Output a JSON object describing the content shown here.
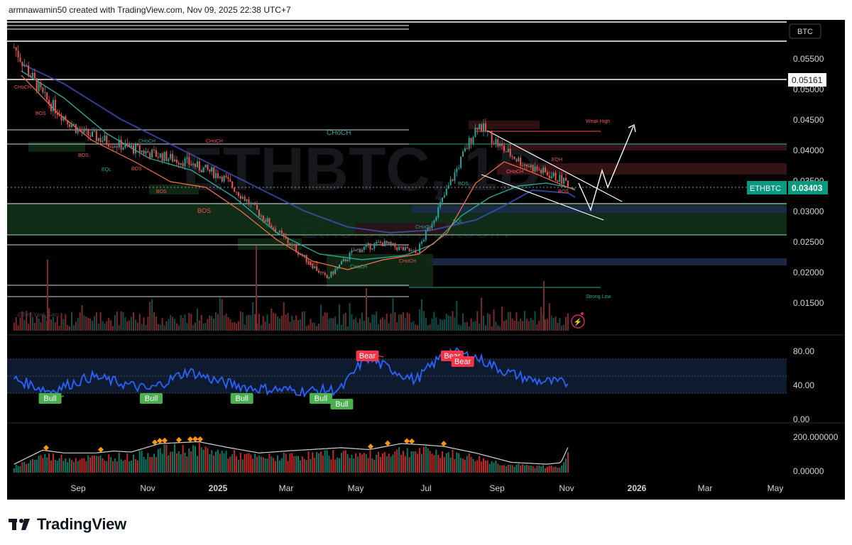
{
  "header": {
    "credit": "armnawamin50 created with TradingView.com, Nov 09, 2025 22:38 UTC+7"
  },
  "footer": {
    "brand": "TradingView"
  },
  "watermark": {
    "symbol": "ETHBTC, 1D",
    "name": "Ethereum / Bitcoin"
  },
  "author_tag": "@NeoYael_Sam",
  "price_axis": {
    "currency_badge": "BTC",
    "ticks": [
      "0.05500",
      "0.05000",
      "0.04500",
      "0.04000",
      "0.03500",
      "0.03000",
      "0.02500",
      "0.02000",
      "0.01500"
    ],
    "level_label": "0.05161",
    "symbol_tag": "ETHBTC",
    "last_price": "0.03403"
  },
  "rsi_axis": {
    "ticks": [
      "80.00",
      "40.00",
      "0.00"
    ]
  },
  "osc_axis": {
    "ticks": [
      "200.000000",
      "0.00000"
    ]
  },
  "time_axis": {
    "labels": [
      "Sep",
      "Nov",
      "2025",
      "Mar",
      "May",
      "Jul",
      "Sep",
      "Nov",
      "2026",
      "Mar",
      "May"
    ]
  },
  "annotations": {
    "choch_big": "CHoCH",
    "bos_big": "BOS",
    "weak_high": "Weak High",
    "strong_low": "Strong Low",
    "eqh": "EQH",
    "eql": "EQL",
    "small_bos": "BOS",
    "small_choch": "CHoCH",
    "bull": "Bull",
    "bear": "Bear"
  },
  "colors": {
    "background": "#000000",
    "up": "#26a69a",
    "down": "#ef5350",
    "rsi_line": "#2962ff",
    "badge_teal": "#089981",
    "bull_badge": "#4caf50",
    "bear_badge": "#f23645",
    "diamond": "#ff9800"
  },
  "chart_data": [
    {
      "type": "line",
      "title": "ETHBTC, 1D",
      "subtitle": "Ethereum / Bitcoin",
      "x": [
        "2024-07-20",
        "2024-08-15",
        "2024-09-15",
        "2024-10-15",
        "2024-11-15",
        "2024-12-15",
        "2025-01-15",
        "2025-02-15",
        "2025-03-15",
        "2025-04-15",
        "2025-05-08",
        "2025-06-01",
        "2025-07-01",
        "2025-07-20",
        "2025-08-23",
        "2025-09-15",
        "2025-10-01",
        "2025-10-20",
        "2025-11-09"
      ],
      "series": [
        {
          "values": [
            0.0548,
            0.047,
            0.0418,
            0.04,
            0.0385,
            0.0372,
            0.035,
            0.0295,
            0.0245,
            0.0193,
            0.0235,
            0.0248,
            0.0232,
            0.03,
            0.0431,
            0.039,
            0.037,
            0.0355,
            0.034
          ]
        }
      ],
      "ylim": [
        0.011,
        0.059
      ],
      "last_price": 0.03403,
      "horizontal_levels": [
        0.05161,
        0.0431,
        0.0409,
        0.0314,
        0.0246,
        0.018,
        0.0162
      ]
    },
    {
      "type": "line",
      "ylim": [
        0,
        100
      ],
      "signals": [
        {
          "label": "Bull",
          "x": "2024-08-20"
        },
        {
          "label": "Bull",
          "x": "2024-11-15"
        },
        {
          "label": "Bull",
          "x": "2025-02-01"
        },
        {
          "label": "Bull",
          "x": "2025-04-10"
        },
        {
          "label": "Bull",
          "x": "2025-04-28"
        },
        {
          "label": "Bear",
          "x": "2025-05-20"
        },
        {
          "label": "Bear",
          "x": "2025-08-01"
        },
        {
          "label": "Bear",
          "x": "2025-08-10"
        }
      ]
    },
    {
      "type": "bar",
      "ylim": [
        0,
        250
      ]
    }
  ]
}
